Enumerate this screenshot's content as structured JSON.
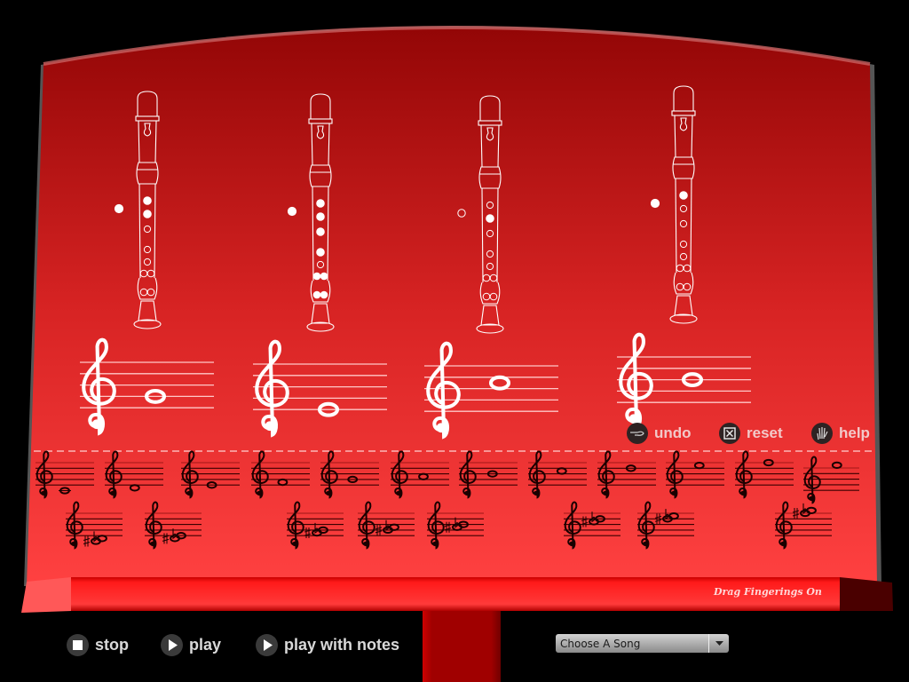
{
  "colors": {
    "board_top": "#960808",
    "board_bottom": "#ff4040",
    "ledge": "#ff1a1a",
    "post": "#a00000",
    "background": "#000000",
    "ink_light": "#ffffff",
    "ink_dark": "#1a0000"
  },
  "recorders": [
    {
      "label": "recorder-1",
      "thumb": "closed",
      "holes": [
        "closed",
        "closed",
        "open",
        "open",
        "open",
        "open-double",
        "open-double"
      ],
      "note": {
        "name": "G4",
        "step": 4
      }
    },
    {
      "label": "recorder-2",
      "thumb": "closed",
      "holes": [
        "closed",
        "closed",
        "closed",
        "closed",
        "open",
        "closed-double",
        "closed-double"
      ],
      "note": {
        "name": "E4",
        "step": 2
      }
    },
    {
      "label": "recorder-3",
      "thumb": "open",
      "holes": [
        "open",
        "closed",
        "open",
        "open",
        "open",
        "open-double",
        "open-double"
      ],
      "note": {
        "name": "C5",
        "step": 7
      }
    },
    {
      "label": "recorder-4",
      "thumb": "closed",
      "holes": [
        "closed",
        "open",
        "open",
        "open",
        "open",
        "open-double",
        "open-double"
      ],
      "note": {
        "name": "B4",
        "step": 6
      }
    }
  ],
  "tools": {
    "undo": {
      "label": "undo",
      "icon": "pointing-hand-icon"
    },
    "reset": {
      "label": "reset",
      "icon": "x-box-icon"
    },
    "help": {
      "label": "help",
      "icon": "open-hand-icon"
    }
  },
  "palette": {
    "naturals": [
      {
        "name": "C4",
        "step": 0
      },
      {
        "name": "D4",
        "step": 1
      },
      {
        "name": "E4",
        "step": 2
      },
      {
        "name": "F4",
        "step": 3
      },
      {
        "name": "G4",
        "step": 4
      },
      {
        "name": "A4",
        "step": 5
      },
      {
        "name": "B4",
        "step": 6
      },
      {
        "name": "C5",
        "step": 7
      },
      {
        "name": "D5",
        "step": 8
      },
      {
        "name": "E5",
        "step": 9
      },
      {
        "name": "F5",
        "step": 10
      },
      {
        "name": "G5",
        "step": 11
      }
    ],
    "accidentals": [
      {
        "name": "C#4/Db4",
        "step": 0
      },
      {
        "name": "D#4/Eb4",
        "step": 1
      },
      {
        "name": "F#4/Gb4",
        "step": 3
      },
      {
        "name": "G#4/Ab4",
        "step": 4
      },
      {
        "name": "A#4/Bb4",
        "step": 5
      },
      {
        "name": "C#5/Db5",
        "step": 7
      },
      {
        "name": "D#5/Eb5",
        "step": 8
      },
      {
        "name": "F#5/Gb5",
        "step": 10
      }
    ]
  },
  "drag_fingerings_label": "Drag Fingerings On",
  "controls": {
    "stop": {
      "label": "stop",
      "icon": "stop-icon"
    },
    "play": {
      "label": "play",
      "icon": "play-icon"
    },
    "play_with_notes": {
      "label": "play with notes",
      "icon": "play-icon"
    }
  },
  "song_select": {
    "value": "Choose A Song"
  }
}
